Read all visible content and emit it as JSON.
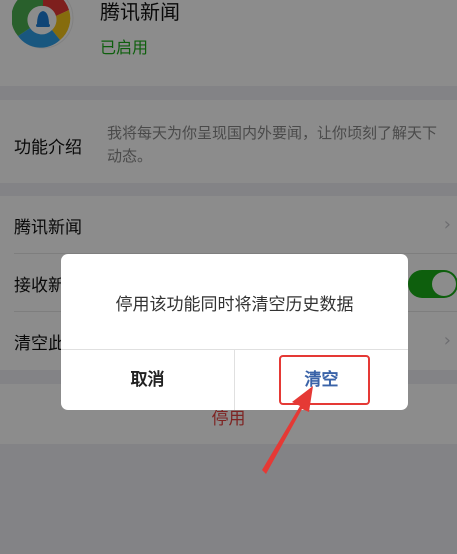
{
  "app": {
    "name": "腾讯新闻",
    "status": "已启用"
  },
  "intro": {
    "label": "功能介绍",
    "text": "我将每天为你呈现国内外要闻，让你顷刻了解天下动态。"
  },
  "settings": {
    "items": [
      {
        "label": "腾讯新闻",
        "chevron": "›"
      },
      {
        "label": "接收新",
        "toggle_on": true
      },
      {
        "label": "清空此",
        "chevron": "›"
      }
    ]
  },
  "disable": {
    "label": "停用"
  },
  "dialog": {
    "message": "停用该功能同时将清空历史数据",
    "cancel_label": "取消",
    "clear_label": "清空"
  },
  "colors": {
    "accent_green": "#1aad19",
    "danger_red": "#e64340",
    "dialog_button_blue": "#3a63a8",
    "annotation_red": "#e53935"
  }
}
